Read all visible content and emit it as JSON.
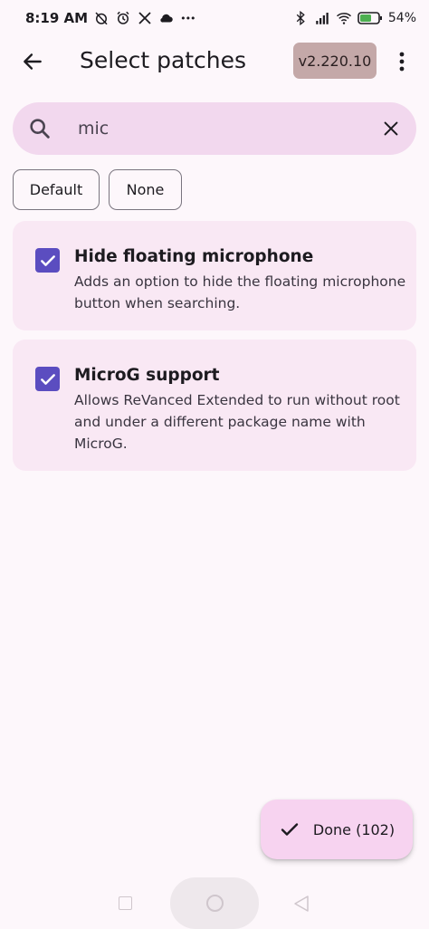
{
  "status_bar": {
    "time": "8:19 AM",
    "battery": "54",
    "icons_left": [
      "alarm-off-icon",
      "alarm-icon",
      "x-logo-icon",
      "cloud-icon",
      "more-dots"
    ],
    "icons_right": [
      "bluetooth-icon",
      "signal-icon",
      "wifi-icon",
      "battery-icon"
    ],
    "more_dots": "•••"
  },
  "app_bar": {
    "title": "Select patches",
    "version": "v2.220.10"
  },
  "search": {
    "value": "mic",
    "placeholder": ""
  },
  "filters": {
    "default_label": "Default",
    "none_label": "None"
  },
  "patches": [
    {
      "name": "Hide floating microphone",
      "description": "Adds an option to hide the floating microphone button when searching.",
      "checked": true
    },
    {
      "name": "MicroG support",
      "description": "Allows ReVanced Extended to run without root and under a different package name with MicroG.",
      "checked": true
    }
  ],
  "fab": {
    "label": "Done (102)"
  },
  "colors": {
    "background": "#fdf7fb",
    "search_bg": "#f2d8ee",
    "card_bg": "#f9e8f4",
    "checkbox": "#5b4dc0",
    "version_badge": "#c4a8a8",
    "fab_bg": "#f7d3f0"
  }
}
